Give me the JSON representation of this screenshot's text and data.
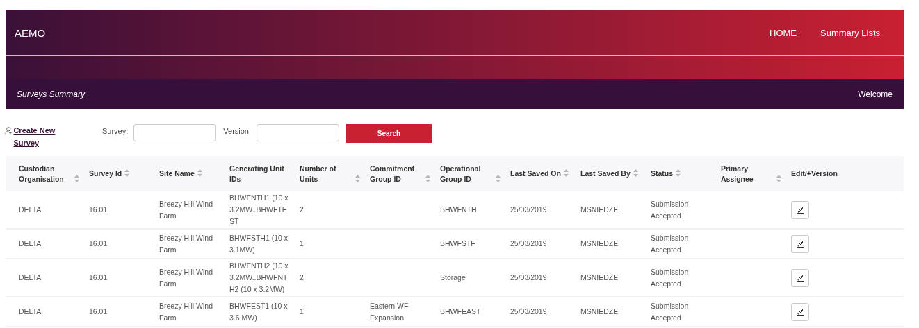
{
  "header": {
    "brand": "AEMO",
    "nav": [
      {
        "label": "HOME"
      },
      {
        "label": "Summary Lists"
      }
    ],
    "page_title": "Surveys Summary",
    "welcome": "Welcome"
  },
  "toolbar": {
    "create_link": "Create New Survey",
    "survey_label": "Survey:",
    "version_label": "Version:",
    "search_button": "Search"
  },
  "table": {
    "columns": [
      {
        "label": "Custodian Organisation",
        "sortable": true
      },
      {
        "label": "Survey Id",
        "sortable": true
      },
      {
        "label": "Site Name",
        "sortable": true
      },
      {
        "label": "Generating Unit IDs",
        "sortable": false
      },
      {
        "label": "Number of Units",
        "sortable": true
      },
      {
        "label": "Commitment Group ID",
        "sortable": true
      },
      {
        "label": "Operational Group ID",
        "sortable": true
      },
      {
        "label": "Last Saved On",
        "sortable": true
      },
      {
        "label": "Last Saved By",
        "sortable": true
      },
      {
        "label": "Status",
        "sortable": true
      },
      {
        "label": "Primary Assignee",
        "sortable": true
      },
      {
        "label": "Edit/+Version",
        "sortable": false
      }
    ],
    "rows": [
      {
        "cells": [
          "DELTA",
          "16.01",
          "Breezy Hill Wind Farm",
          "BHWFNTH1 (10 x 3.2MW..BHWFTEST",
          "2",
          "",
          "BHWFNTH",
          "25/03/2019",
          "MSNIEDZE",
          "Submission Accepted",
          ""
        ]
      },
      {
        "cells": [
          "DELTA",
          "16.01",
          "Breezy Hill Wind Farm",
          "BHWFSTH1 (10 x 3.1MW)",
          "1",
          "",
          "BHWFSTH",
          "25/03/2019",
          "MSNIEDZE",
          "Submission Accepted",
          ""
        ]
      },
      {
        "cells": [
          "DELTA",
          "16.01",
          "Breezy Hill Wind Farm",
          "BHWFNTH2 (10 x 3.2MW..BHWFNTH2 (10 x 3.2MW)",
          "2",
          "",
          "Storage",
          "25/03/2019",
          "MSNIEDZE",
          "Submission Accepted",
          ""
        ]
      },
      {
        "cells": [
          "DELTA",
          "16.01",
          "Breezy Hill Wind Farm",
          "BHWFEST1 (10 x 3.6 MW)",
          "1",
          "Eastern WF Expansion",
          "BHWFEAST",
          "25/03/2019",
          "MSNIEDZE",
          "Submission Accepted",
          ""
        ]
      }
    ]
  }
}
